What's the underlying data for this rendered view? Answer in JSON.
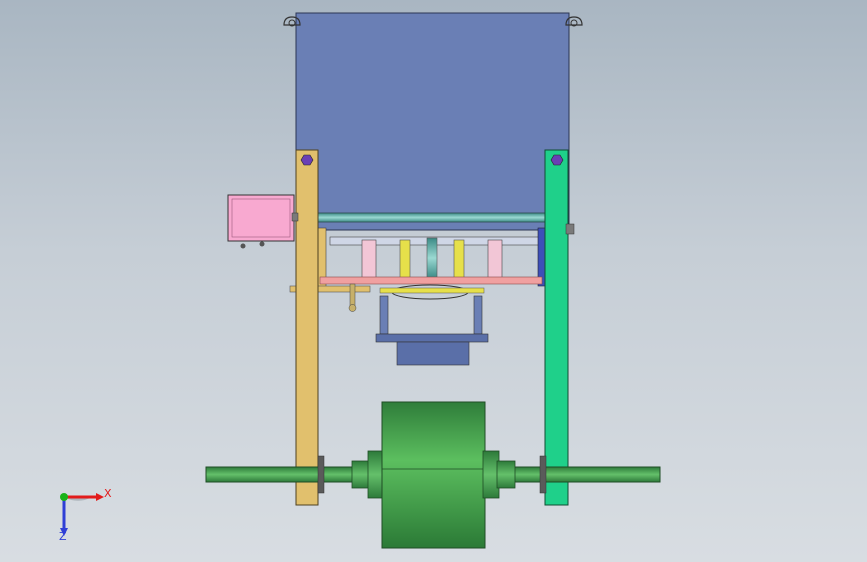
{
  "viewport": {
    "background_top": "#a9b6c2",
    "background_bottom": "#d8dde2"
  },
  "model": {
    "colors": {
      "hopper": "#6a7fb5",
      "left_frame": "#e1c06d",
      "right_frame": "#1fd08a",
      "motor_box": "#f8a9d0",
      "shaft": "#3f9b4f",
      "drum": "#4ca64f",
      "blue_tray": "#5a6fa8",
      "pink_bar": "#f0a0a0",
      "teal_rod": "#5aa9a3"
    }
  },
  "triad": {
    "x_label": "X",
    "z_label": "Z",
    "x_color": "#e21b1b",
    "y_color": "#19b319",
    "z_color": "#2f3fd6"
  }
}
